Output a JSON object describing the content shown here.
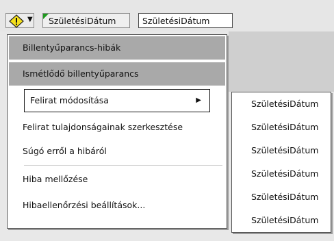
{
  "toolbar": {
    "error_icon": "warning-diamond-icon",
    "dropdown_icon": "chevron-down-icon",
    "label_control_text": "SzületésiDátum",
    "text_control_text": "SzületésiDátum",
    "error_indicator_color": "#1e9a1e"
  },
  "menu": {
    "items": [
      {
        "label": "Billentyűparancs-hibák"
      },
      {
        "label": "Ismétlődő billentyűparancs"
      },
      {
        "label": "Felirat módosítása"
      },
      {
        "label": "Felirat tulajdonságainak szerkesztése"
      },
      {
        "label": "Súgó erről a hibáról"
      },
      {
        "label": "Hiba mellőzése"
      },
      {
        "label": "Hibaellenőrzési beállítások..."
      }
    ]
  },
  "submenu": {
    "items": [
      {
        "label": "SzületésiDátum"
      },
      {
        "label": "SzületésiDátum"
      },
      {
        "label": "SzületésiDátum"
      },
      {
        "label": "SzületésiDátum"
      },
      {
        "label": "SzületésiDátum"
      },
      {
        "label": "SzületésiDátum"
      }
    ]
  }
}
